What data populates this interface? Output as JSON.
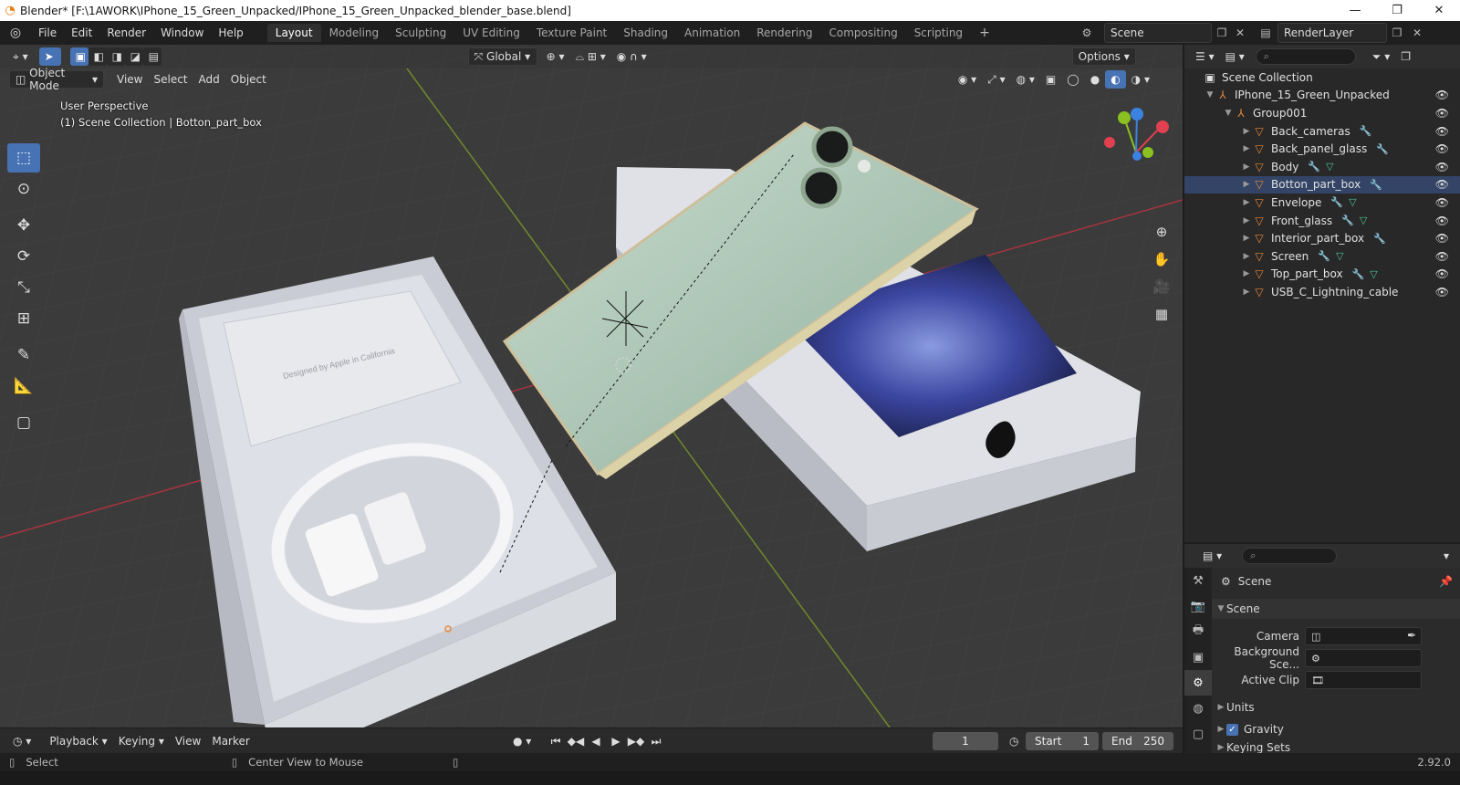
{
  "window": {
    "title": "Blender* [F:\\1AWORK\\IPhone_15_Green_Unpacked/IPhone_15_Green_Unpacked_blender_base.blend]",
    "minimize": "—",
    "maximize": "❐",
    "close": "✕"
  },
  "menu": [
    "File",
    "Edit",
    "Render",
    "Window",
    "Help"
  ],
  "workspace_tabs": [
    "Layout",
    "Modeling",
    "Sculpting",
    "UV Editing",
    "Texture Paint",
    "Shading",
    "Animation",
    "Rendering",
    "Compositing",
    "Scripting",
    "+"
  ],
  "active_tab": "Layout",
  "scene_selector": "Scene",
  "view_layer": "RenderLayer",
  "viewport": {
    "transform_orientation": "Global",
    "options_label": "Options",
    "mode": "Object Mode",
    "header_menus": [
      "View",
      "Select",
      "Add",
      "Object"
    ],
    "overlay_line1": "User Perspective",
    "overlay_line2": "(1) Scene Collection | Botton_part_box",
    "box_print": "Designed by Apple in California"
  },
  "outliner": {
    "root": "Scene Collection",
    "collection": "IPhone_15_Green_Unpacked",
    "group": "Group001",
    "objects": [
      {
        "name": "Back_cameras",
        "mods": true,
        "mesh": false,
        "extra": "curve"
      },
      {
        "name": "Back_panel_glass",
        "mods": true,
        "mesh": false
      },
      {
        "name": "Body",
        "mods": true,
        "mesh": true
      },
      {
        "name": "Botton_part_box",
        "mods": true,
        "mesh": false,
        "selected": true
      },
      {
        "name": "Envelope",
        "mods": true,
        "mesh": true
      },
      {
        "name": "Front_glass",
        "mods": true,
        "mesh": true
      },
      {
        "name": "Interior_part_box",
        "mods": true,
        "mesh": false
      },
      {
        "name": "Screen",
        "mods": true,
        "mesh": true
      },
      {
        "name": "Top_part_box",
        "mods": true,
        "mesh": true
      },
      {
        "name": "USB_C_Lightning_cable",
        "mods": false,
        "mesh": false
      }
    ]
  },
  "properties": {
    "context": "Scene",
    "panel": "Scene",
    "camera_label": "Camera",
    "background_label": "Background Sce...",
    "active_clip_label": "Active Clip",
    "units_label": "Units",
    "gravity_label": "Gravity",
    "keying_label": "Keying Sets"
  },
  "timeline": {
    "menus": [
      "Playback",
      "Keying",
      "View",
      "Marker"
    ],
    "current_frame": "1",
    "start_label": "Start",
    "start": "1",
    "end_label": "End",
    "end": "250"
  },
  "status": {
    "select": "Select",
    "center": "Center View to Mouse",
    "version": "2.92.0"
  },
  "colors": {
    "accent": "#4772b3",
    "object_orange": "#e8883a",
    "axis_x": "#e04050",
    "axis_y": "#8ac020",
    "axis_z": "#3c82e0"
  }
}
